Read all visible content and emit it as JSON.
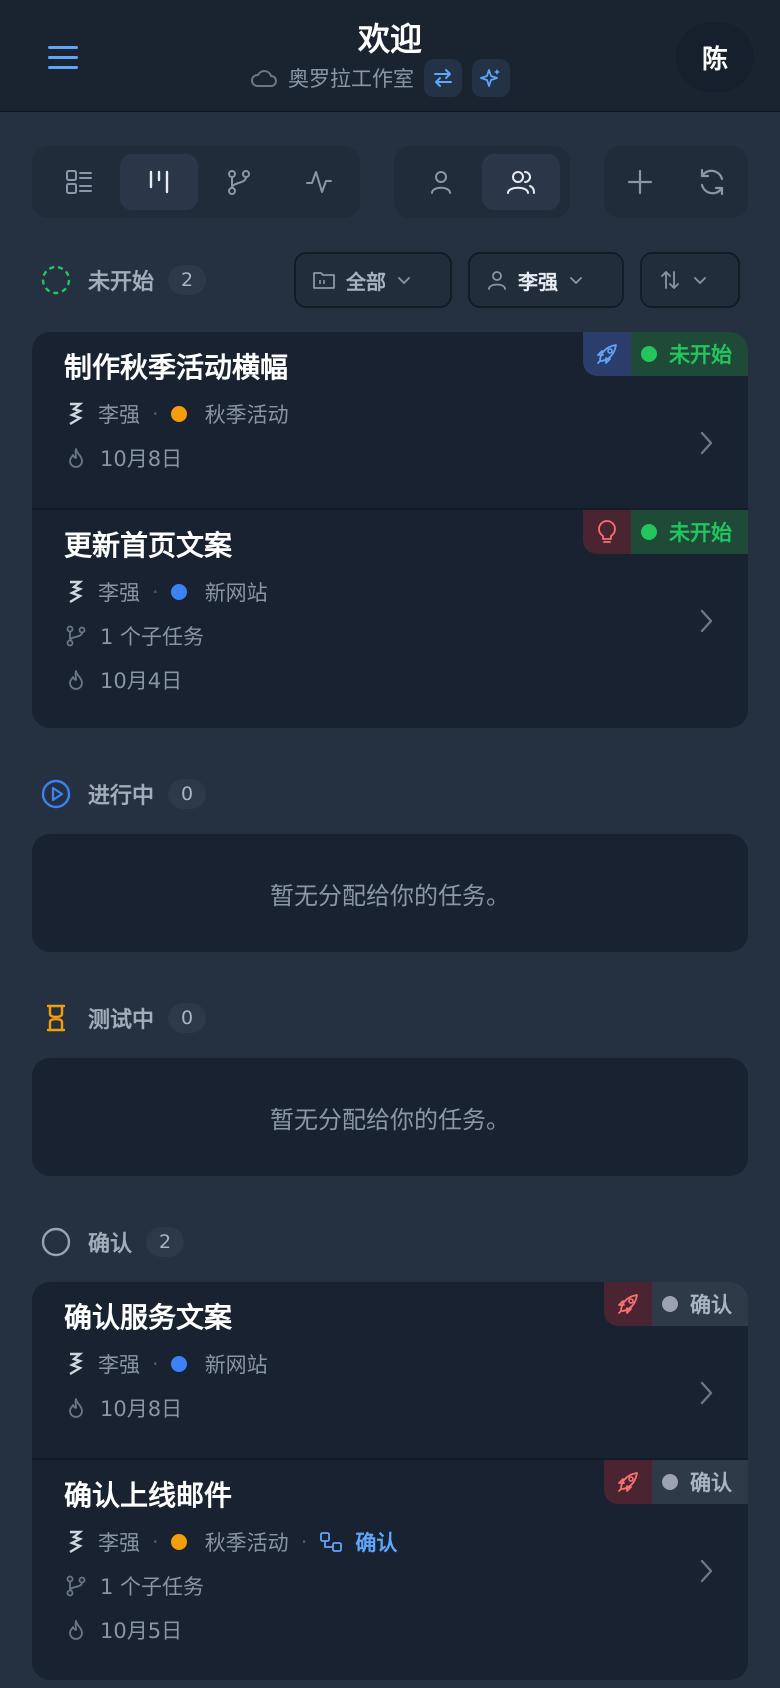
{
  "header": {
    "title": "欢迎",
    "workspace": "奥罗拉工作室",
    "avatar_initial": "陈"
  },
  "filters": {
    "project": "全部",
    "assignee": "李强"
  },
  "sections": [
    {
      "label": "未开始",
      "count": "2",
      "tasks": [
        {
          "title": "制作秋季活动横幅",
          "assignee": "李强",
          "project": "秋季活动",
          "project_color": "#f59e0b",
          "date": "10月8日",
          "status": "未开始",
          "type_icon": "rocket-icon"
        },
        {
          "title": "更新首页文案",
          "assignee": "李强",
          "project": "新网站",
          "project_color": "#3b82f6",
          "subtasks": "1 个子任务",
          "date": "10月4日",
          "status": "未开始",
          "type_icon": "lightbulb-icon"
        }
      ]
    },
    {
      "label": "进行中",
      "count": "0",
      "empty_text": "暂无分配给你的任务。"
    },
    {
      "label": "测试中",
      "count": "0",
      "empty_text": "暂无分配给你的任务。"
    },
    {
      "label": "确认",
      "count": "2",
      "tasks": [
        {
          "title": "确认服务文案",
          "assignee": "李强",
          "project": "新网站",
          "project_color": "#3b82f6",
          "date": "10月8日",
          "status": "确认",
          "type_icon": "rocket-icon"
        },
        {
          "title": "确认上线邮件",
          "assignee": "李强",
          "project": "秋季活动",
          "project_color": "#f59e0b",
          "workflow": "确认",
          "subtasks": "1 个子任务",
          "date": "10月5日",
          "status": "确认",
          "type_icon": "rocket-icon"
        }
      ]
    }
  ],
  "colors": {
    "background": "#253141",
    "card": "#192230",
    "status_green": "#22c55e",
    "status_gray": "#9aa3af",
    "accent_blue": "#3b82f6",
    "accent_orange": "#f59e0b",
    "link_blue": "#60a5fa"
  }
}
